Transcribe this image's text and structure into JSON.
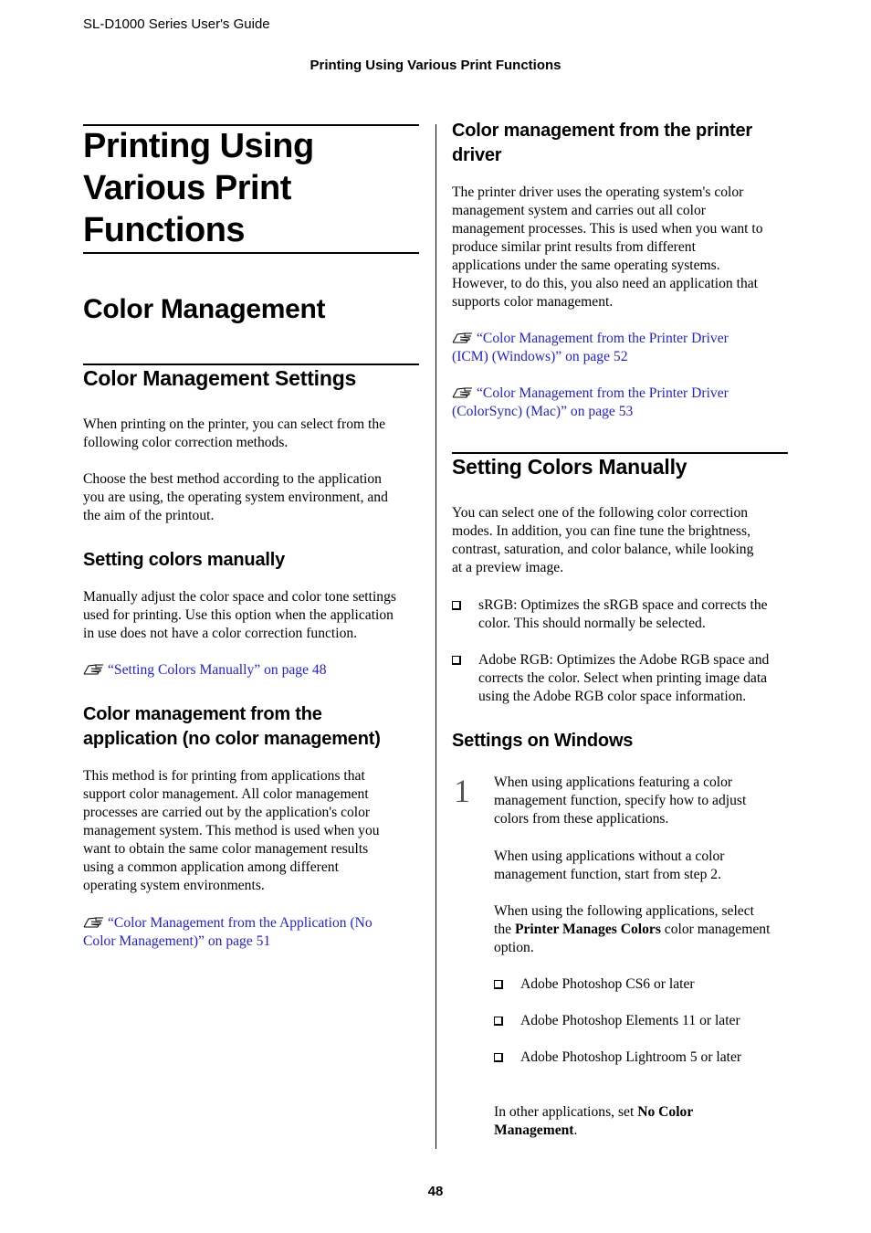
{
  "header": {
    "running_head": "SL-D1000 Series User's Guide",
    "section_head": "Printing Using Various Print Functions"
  },
  "left_column": {
    "chapter_title_lines": [
      "Printing Using",
      "Various Print",
      "Functions"
    ],
    "section_title": "Color Management",
    "subsection_title": "Color Management Settings",
    "intro_paragraphs": [
      [
        "When printing on the printer, you can select from the",
        "following color correction methods."
      ],
      [
        "Choose the best method according to the application",
        "you are using, the operating system environment, and",
        "the aim of the printout."
      ]
    ],
    "manual": {
      "heading": "Setting colors manually",
      "paragraph": [
        "Manually adjust the color space and color tone settings",
        "used for printing. Use this option when the application",
        "in use does not have a color correction function."
      ],
      "link": "“Setting Colors Manually” on page 48"
    },
    "app_cm": {
      "heading_lines": [
        "Color management from the",
        "application (no color management)"
      ],
      "paragraph": [
        "This method is for printing from applications that",
        "support color management. All color management",
        "processes are carried out by the application's color",
        "management system. This method is used when you",
        "want to obtain the same color management results",
        "using a common application among different",
        "operating system environments."
      ],
      "link_lines": [
        "“Color Management from the Application (No",
        "Color Management)” on page 51"
      ]
    }
  },
  "right_column": {
    "driver_cm": {
      "heading_lines": [
        "Color management from the printer",
        "driver"
      ],
      "paragraph": [
        "The printer driver uses the operating system's color",
        "management system and carries out all color",
        "management processes. This is used when you want to",
        "produce similar print results from different",
        "applications under the same operating systems.",
        "However, to do this, you also need an application that",
        "supports color management."
      ],
      "links": [
        [
          "“Color Management from the Printer Driver",
          "(ICM) (Windows)” on page 52"
        ],
        [
          "“Color Management from the Printer Driver",
          "(ColorSync) (Mac)” on page 53"
        ]
      ]
    },
    "setting_manually": {
      "heading": "Setting Colors Manually",
      "paragraph": [
        "You can select one of the following color correction",
        "modes. In addition, you can fine tune the brightness,",
        "contrast, saturation, and color balance, while looking",
        "at a preview image."
      ],
      "bullets": [
        [
          "sRGB: Optimizes the sRGB space and corrects the",
          "color. This should normally be selected."
        ],
        [
          "Adobe RGB: Optimizes the Adobe RGB space and",
          "corrects the color. Select when printing image data",
          "using the Adobe RGB color space information."
        ]
      ]
    },
    "windows": {
      "heading": "Settings on Windows",
      "step_number": "1",
      "step_paragraphs": [
        [
          "When using applications featuring a color",
          "management function, specify how to adjust",
          "colors from these applications."
        ],
        [
          "When using applications without a color",
          "management function, start from step 2."
        ]
      ],
      "select_line1": "When using the following applications, select",
      "select_line2_pre": "the ",
      "select_line2_bold": "Printer Manages Colors",
      "select_line2_post": " color management",
      "select_line3": "option.",
      "apps": [
        "Adobe Photoshop CS6 or later",
        "Adobe Photoshop Elements 11 or later",
        "Adobe Photoshop Lightroom 5 or later"
      ],
      "other_pre": "In other applications, set ",
      "other_bold1": "No Color",
      "other_bold2": "Management",
      "other_post": "."
    }
  },
  "footer": {
    "page_number": "48"
  },
  "colors": {
    "link": "#1f1fe0",
    "text": "#000000"
  }
}
